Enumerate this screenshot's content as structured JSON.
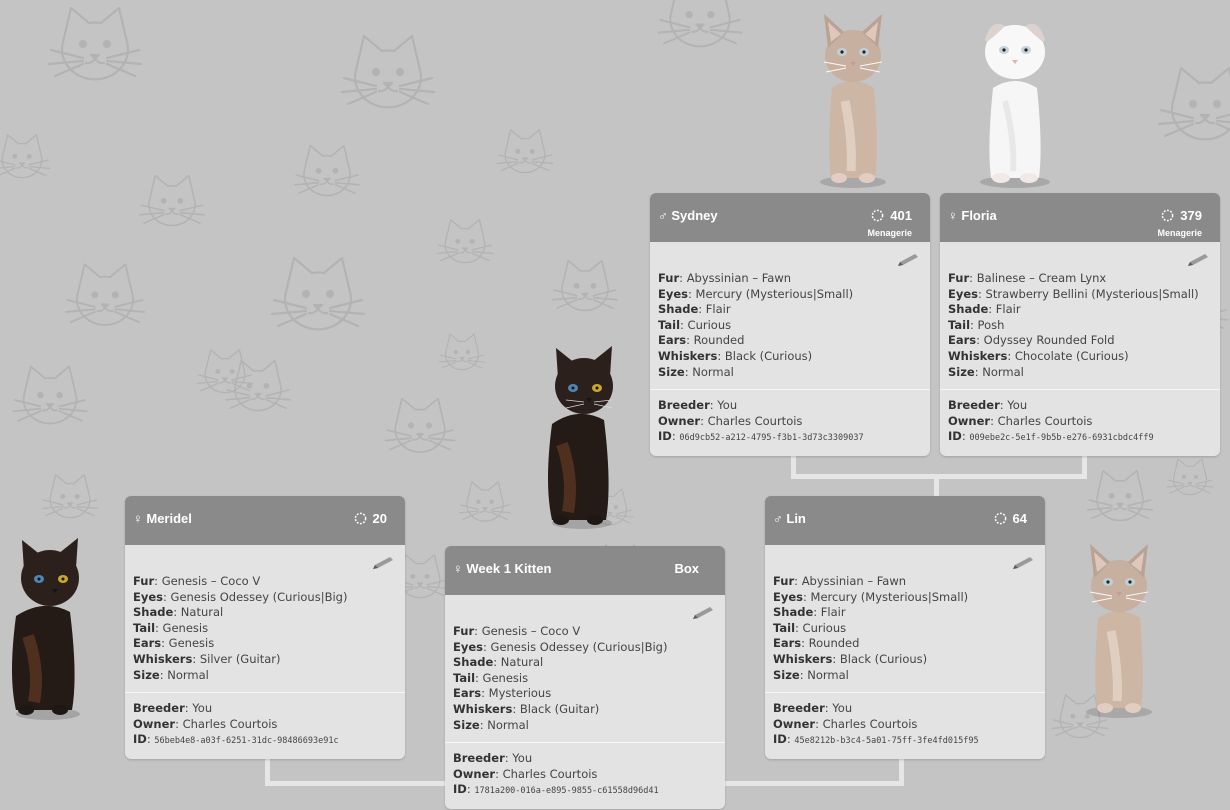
{
  "sire": {
    "sex_symbol": "♂",
    "name": "Sydney",
    "count": "401",
    "sub_label": "Menagerie",
    "traits": {
      "fur": "Abyssinian – Fawn",
      "eyes": "Mercury (Mysterious|Small)",
      "shade": "Flair",
      "tail": "Curious",
      "ears": "Rounded",
      "whiskers": "Black (Curious)",
      "size": "Normal"
    },
    "breeder": "You",
    "owner": "Charles Courtois",
    "id": "06d9cb52-a212-4795-f3b1-3d73c3309037"
  },
  "dam": {
    "sex_symbol": "♀",
    "name": "Floria",
    "count": "379",
    "sub_label": "Menagerie",
    "traits": {
      "fur": "Balinese – Cream Lynx",
      "eyes": "Strawberry Bellini (Mysterious|Small)",
      "shade": "Flair",
      "tail": "Posh",
      "ears": "Odyssey Rounded Fold",
      "whiskers": "Chocolate (Curious)",
      "size": "Normal"
    },
    "breeder": "You",
    "owner": "Charles Courtois",
    "id": "009ebe2c-5e1f-9b5b-e276-6931cbdc4ff9"
  },
  "meridel": {
    "sex_symbol": "♀",
    "name": "Meridel",
    "count": "20",
    "traits": {
      "fur": "Genesis – Coco V",
      "eyes": "Genesis Odessey (Curious|Big)",
      "shade": "Natural",
      "tail": "Genesis",
      "ears": "Genesis",
      "whiskers": "Silver (Guitar)",
      "size": "Normal"
    },
    "breeder": "You",
    "owner": "Charles Courtois",
    "id": "56beb4e8-a03f-6251-31dc-98486693e91c"
  },
  "kitten": {
    "sex_symbol": "♀",
    "name": "Week 1 Kitten",
    "box_label": "Box",
    "traits": {
      "fur": "Genesis – Coco V",
      "eyes": "Genesis Odessey (Curious|Big)",
      "shade": "Natural",
      "tail": "Genesis",
      "ears": "Mysterious",
      "whiskers": "Black (Guitar)",
      "size": "Normal"
    },
    "breeder": "You",
    "owner": "Charles Courtois",
    "id": "1781a200-016a-e895-9855-c61558d96d41"
  },
  "lin": {
    "sex_symbol": "♂",
    "name": "Lin",
    "count": "64",
    "traits": {
      "fur": "Abyssinian – Fawn",
      "eyes": "Mercury (Mysterious|Small)",
      "shade": "Flair",
      "tail": "Curious",
      "ears": "Rounded",
      "whiskers": "Black (Curious)",
      "size": "Normal"
    },
    "breeder": "You",
    "owner": "Charles Courtois",
    "id": "45e8212b-b3c4-5a01-75ff-3fe4fd015f95"
  },
  "labels": {
    "fur": "Fur",
    "eyes": "Eyes",
    "shade": "Shade",
    "tail": "Tail",
    "ears": "Ears",
    "whiskers": "Whiskers",
    "size": "Size",
    "breeder": "Breeder",
    "owner": "Owner",
    "id": "ID"
  },
  "colors": {
    "background": "#c4c4c4",
    "card_header": "#8a8a8a",
    "card_body": "#e3e3e3",
    "connector": "#e6e6e6"
  }
}
